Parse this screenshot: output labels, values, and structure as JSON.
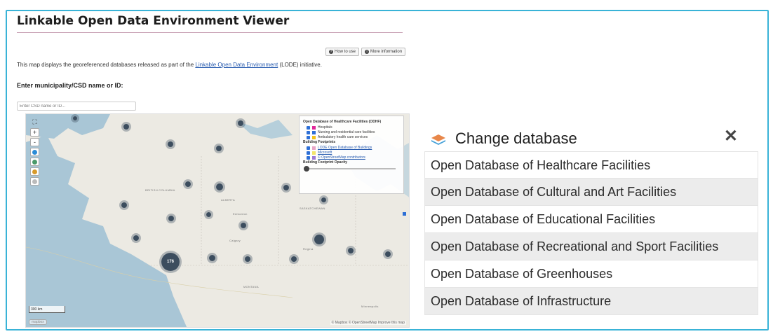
{
  "header": {
    "title": "Linkable Open Data Environment Viewer",
    "how_to_use": "How to use",
    "more_info": "More information"
  },
  "description": {
    "prefix": "This map displays the georeferenced databases released as part of the ",
    "link": "Linkable Open Data Environment",
    "suffix": " (LODE) initiative."
  },
  "search": {
    "label": "Enter municipality/CSD name or ID:",
    "placeholder": "Enter CSD name or ID..."
  },
  "map": {
    "controls": [
      "+",
      "-"
    ],
    "legend": {
      "section1_title": "Open Database of Healthcare Facilities (ODHF)",
      "items1": [
        {
          "label": "Hospitals",
          "color": "#e0279a"
        },
        {
          "label": "Nursing and residential care facilities",
          "color": "#2f6fd6"
        },
        {
          "label": "Ambulatory health care services",
          "color": "#f2c21b"
        }
      ],
      "section2_title": "Building Footprints",
      "items2": [
        {
          "label": "LODE Open Database of Buildings",
          "color": "#e8a6c8"
        },
        {
          "label": "Microsoft",
          "color": "#f3e46b"
        },
        {
          "label": "© OpenStreetMap contributors",
          "color": "#9d7ad6"
        }
      ],
      "opacity_label": "Building Footprint Opacity",
      "opacity_value": 0
    },
    "scale": "300 km",
    "attribution": "© Mapbox © OpenStreetMap Improve this map",
    "logo": "mapbox",
    "big_cluster": "176",
    "place_names": [
      "BRITISH COLUMBIA",
      "ALBERTA",
      "SASKATCHEWAN",
      "Edmonton",
      "Calgary",
      "Regina",
      "MONTANA",
      "Minneapolis"
    ]
  },
  "panel": {
    "title": "Change database",
    "close_icon": "close-icon",
    "databases": [
      "Open Database of Healthcare Facilities",
      "Open Database of Cultural and Art Facilities",
      "Open Database of Educational Facilities",
      "Open Database of Recreational and Sport Facilities",
      "Open Database of Greenhouses",
      "Open Database of Infrastructure"
    ]
  },
  "colors": {
    "frame_border": "#39b3d7",
    "cluster": "#3c4d5e",
    "ocean": "#a9c6d6",
    "land": "#eceae3",
    "alt_row": "#ececec"
  }
}
